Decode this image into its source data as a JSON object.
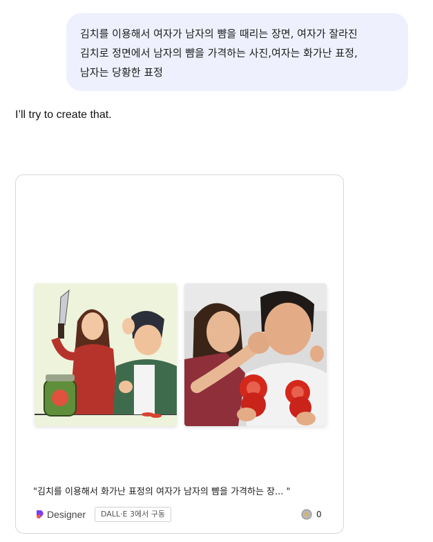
{
  "conversation": {
    "user_message": {
      "lines": [
        "김치를 이용해서 여자가 남자의 뺨을 때리는 장면, 여자가 잘라진",
        "김치로 정면에서 남자의 뺨을 가격하는 사진,여자는 화가난 표정,",
        "남자는 당황한 표정"
      ]
    },
    "assistant_reply": "I’ll try to create that.",
    "image_card": {
      "images": [
        {
          "icon": "illustration-woman-knife-kimchi-jar"
        },
        {
          "icon": "photo-woman-punching-man-tomato-slices"
        }
      ],
      "caption": "\"김치를 이용해서 화가난 표정의 여자가 남자의 뺨을 가격하는 장...  \"",
      "designer_label": "Designer",
      "badge": "DALL·E 3에서 구동",
      "like_count": "0"
    }
  },
  "colors": {
    "user_bubble_bg": "#eef1fd",
    "card_border": "#d7d7d7",
    "designer_logo": "#7b3ff2"
  }
}
